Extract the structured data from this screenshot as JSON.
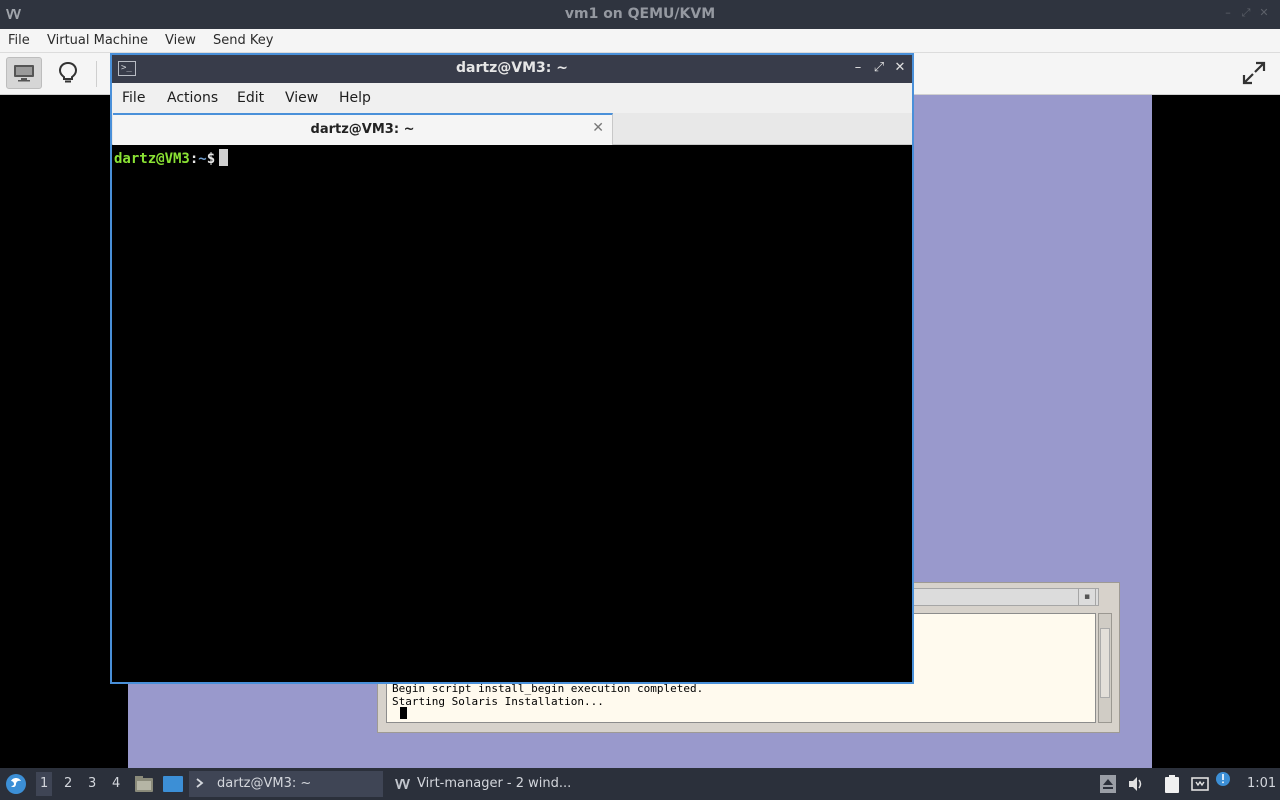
{
  "vm_window": {
    "title": "vm1 on QEMU/KVM",
    "menu": [
      "File",
      "Virtual Machine",
      "View",
      "Send Key"
    ]
  },
  "guest": {
    "installer_lines": [
      "Begin script install_begin execution completed.",
      "Starting Solaris Installation..."
    ]
  },
  "terminal": {
    "title": "dartz@VM3: ~",
    "menu": [
      "File",
      "Actions",
      "Edit",
      "View",
      "Help"
    ],
    "tab_label": "dartz@VM3: ~",
    "prompt": {
      "user_host": "dartz@VM3",
      "colon": ":",
      "path": "~",
      "symbol": "$"
    }
  },
  "taskbar": {
    "workspaces": [
      "1",
      "2",
      "3",
      "4"
    ],
    "active_workspace": "1",
    "tasks": [
      {
        "label": "dartz@VM3: ~",
        "active": true
      },
      {
        "label": "Virt-manager - 2 wind...",
        "active": false
      }
    ],
    "clock": "1:01"
  },
  "colors": {
    "accent": "#4a90d9",
    "guest_background": "#9999cc",
    "prompt_user": "#8ae234",
    "prompt_path": "#729fcf"
  }
}
